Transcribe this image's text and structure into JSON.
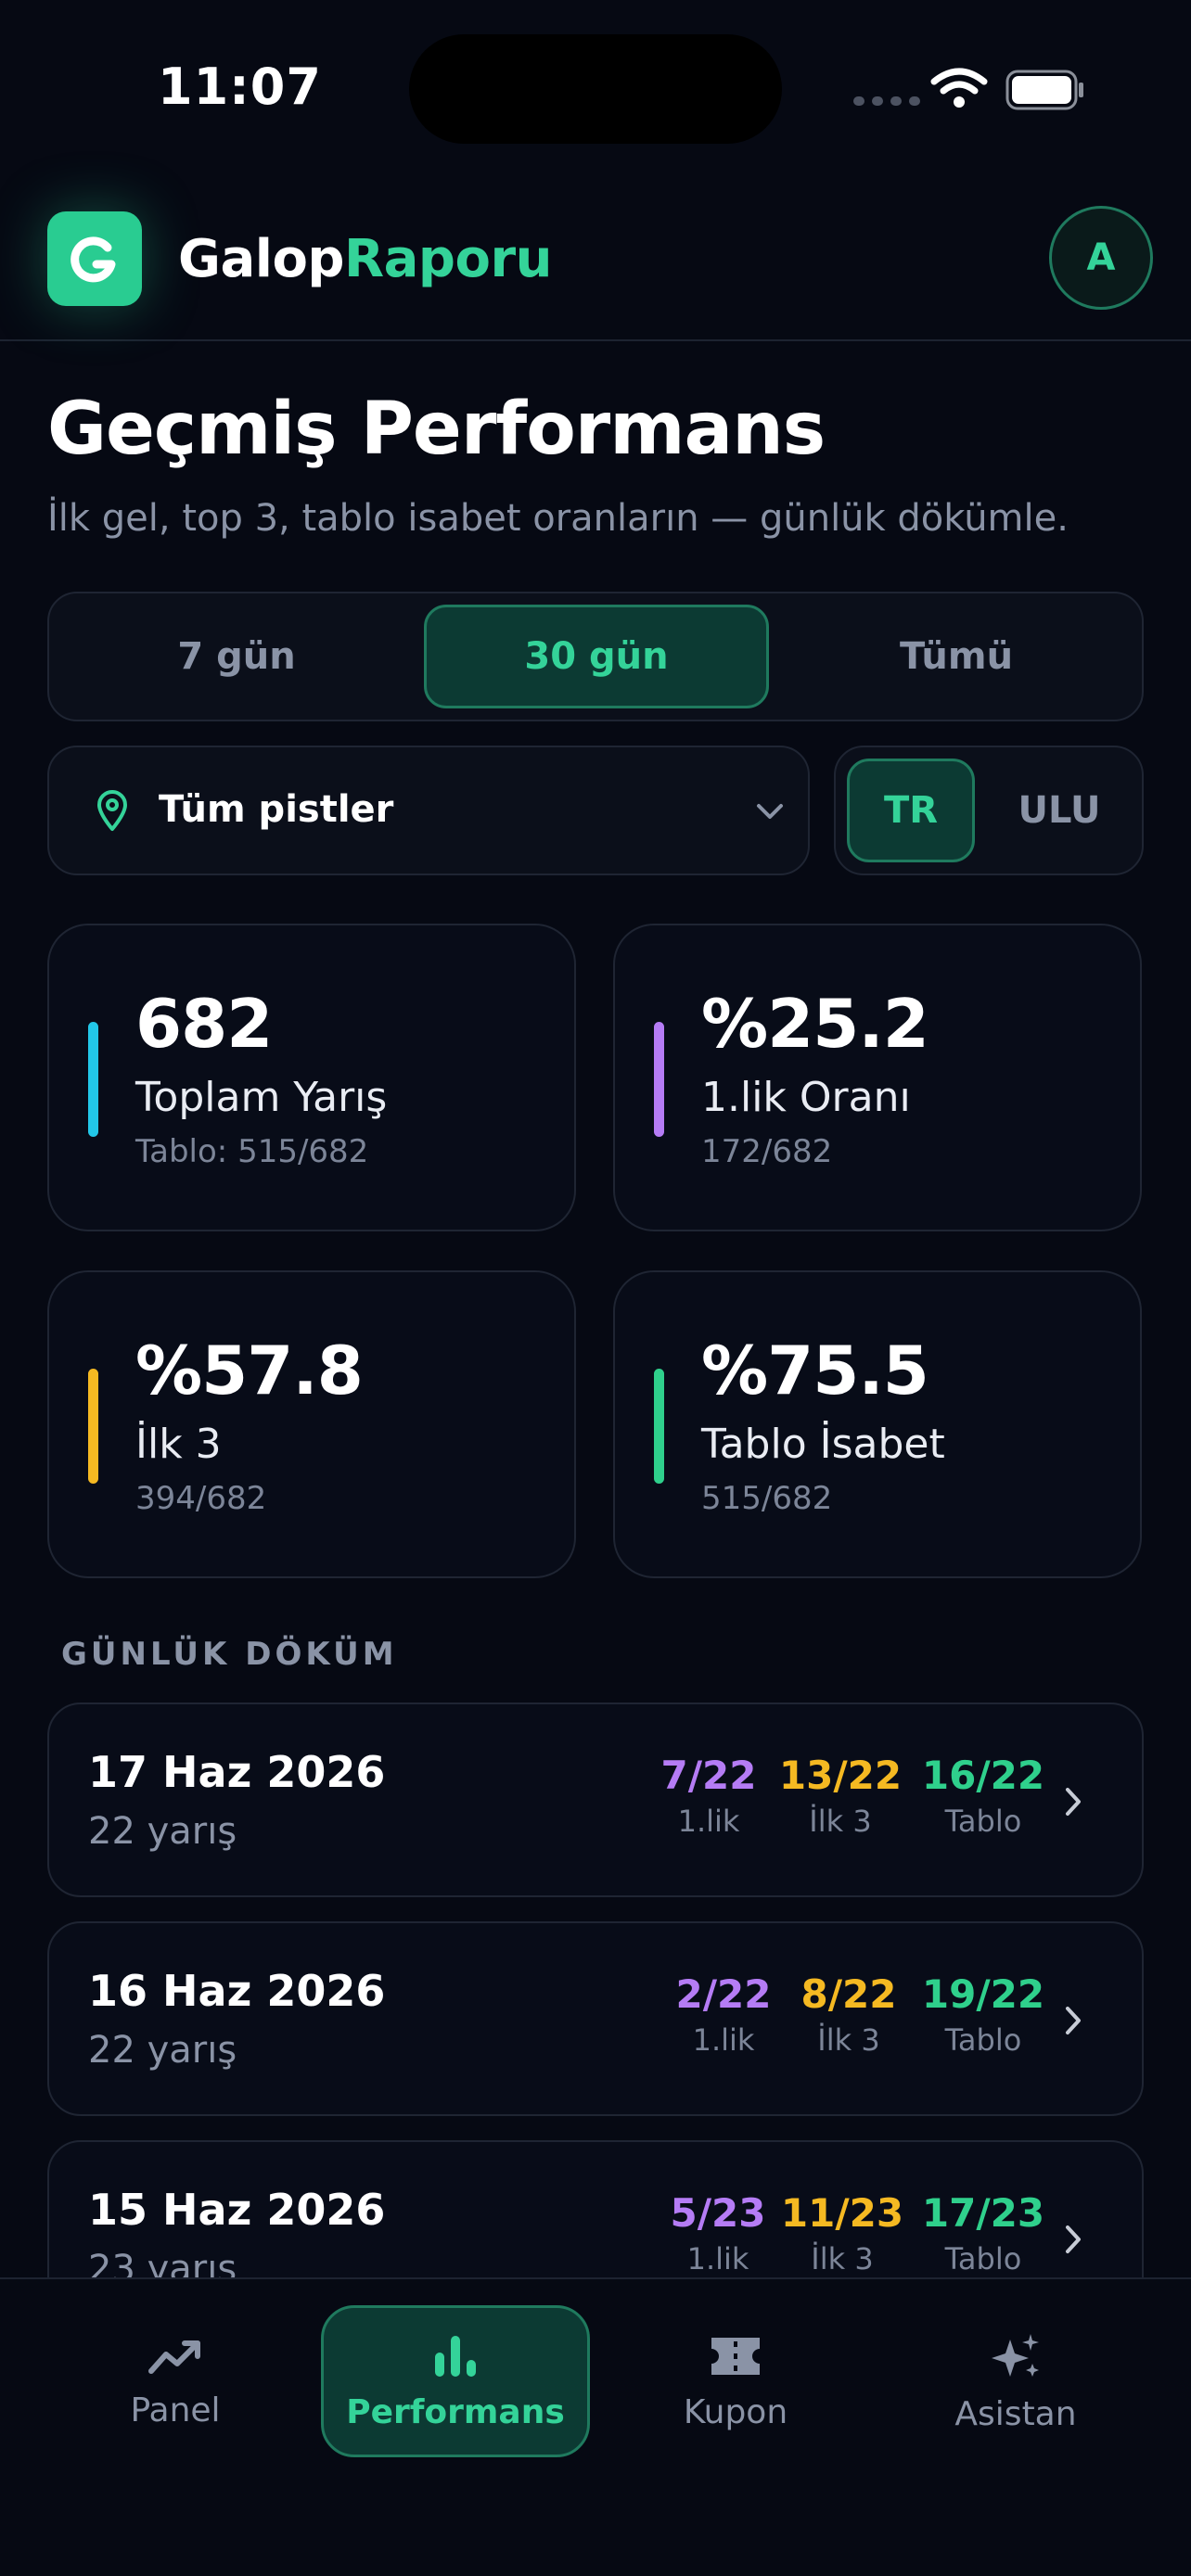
{
  "status_bar": {
    "time": "11:07"
  },
  "header": {
    "brand_part1": "Galop",
    "brand_part2": "Raporu",
    "avatar_initial": "A"
  },
  "page": {
    "title": "Geçmiş Performans",
    "subtitle": "İlk gel, top 3, tablo isabet oranların — günlük dökümle."
  },
  "range_tabs": [
    {
      "label": "7 gün",
      "active": false
    },
    {
      "label": "30 gün",
      "active": true
    },
    {
      "label": "Tümü",
      "active": false
    }
  ],
  "track_filter": {
    "value": "Tüm pistler"
  },
  "region_tabs": [
    {
      "label": "TR",
      "active": true
    },
    {
      "label": "ULU",
      "active": false
    }
  ],
  "stats": [
    {
      "value": "682",
      "label": "Toplam Yarış",
      "sub": "Tablo: 515/682",
      "color": "#22c7e8"
    },
    {
      "value": "%25.2",
      "label": "1.lik Oranı",
      "sub": "172/682",
      "color": "#b57cf5"
    },
    {
      "value": "%57.8",
      "label": "İlk 3",
      "sub": "394/682",
      "color": "#f5b922"
    },
    {
      "value": "%75.5",
      "label": "Tablo İsabet",
      "sub": "515/682",
      "color": "#2fd08c"
    }
  ],
  "daily": {
    "section_title": "GÜNLÜK DÖKÜM",
    "metric_labels": {
      "first": "1.lik",
      "top3": "İlk 3",
      "tablo": "Tablo"
    },
    "rows": [
      {
        "date": "17 Haz 2026",
        "races": "22 yarış",
        "first": "7/22",
        "top3": "13/22",
        "tablo": "16/22"
      },
      {
        "date": "16 Haz 2026",
        "races": "22 yarış",
        "first": "2/22",
        "top3": "8/22",
        "tablo": "19/22"
      },
      {
        "date": "15 Haz 2026",
        "races": "23 yarış",
        "first": "5/23",
        "top3": "11/23",
        "tablo": "17/23"
      }
    ]
  },
  "colors": {
    "accent": "#34d399",
    "purple": "#b57cf5",
    "amber": "#f5b922",
    "green": "#2fd08c"
  },
  "bottom_nav": [
    {
      "label": "Panel",
      "icon": "trend-up-icon",
      "active": false
    },
    {
      "label": "Performans",
      "icon": "bar-chart-icon",
      "active": true
    },
    {
      "label": "Kupon",
      "icon": "ticket-icon",
      "active": false
    },
    {
      "label": "Asistan",
      "icon": "sparkles-icon",
      "active": false
    }
  ]
}
